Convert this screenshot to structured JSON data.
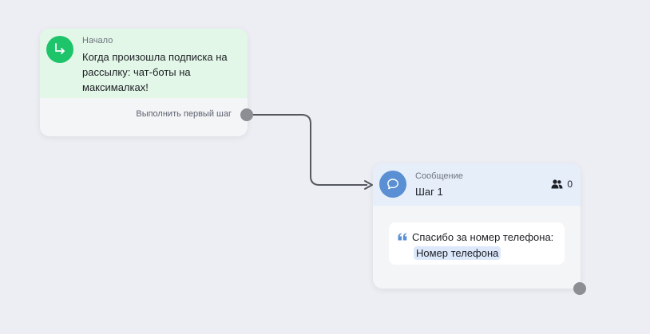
{
  "start_node": {
    "type_label": "Начало",
    "title": "Когда произошла подписка на рассылку: чат-боты на максималках!",
    "action_label": "Выполнить первый шаг",
    "icon": "arrow-turn-down-right-icon",
    "color": "#1ec46a",
    "header_color": "#e2f7e8"
  },
  "message_node": {
    "type_label": "Сообщение",
    "title": "Шаг 1",
    "subscribers_count": "0",
    "icon": "chat-bubble-icon",
    "color": "#5b8fd4",
    "header_color": "#e6eefa",
    "message": {
      "text_before": "Спасибо за номер телефона:",
      "variable": "Номер телефона"
    }
  }
}
